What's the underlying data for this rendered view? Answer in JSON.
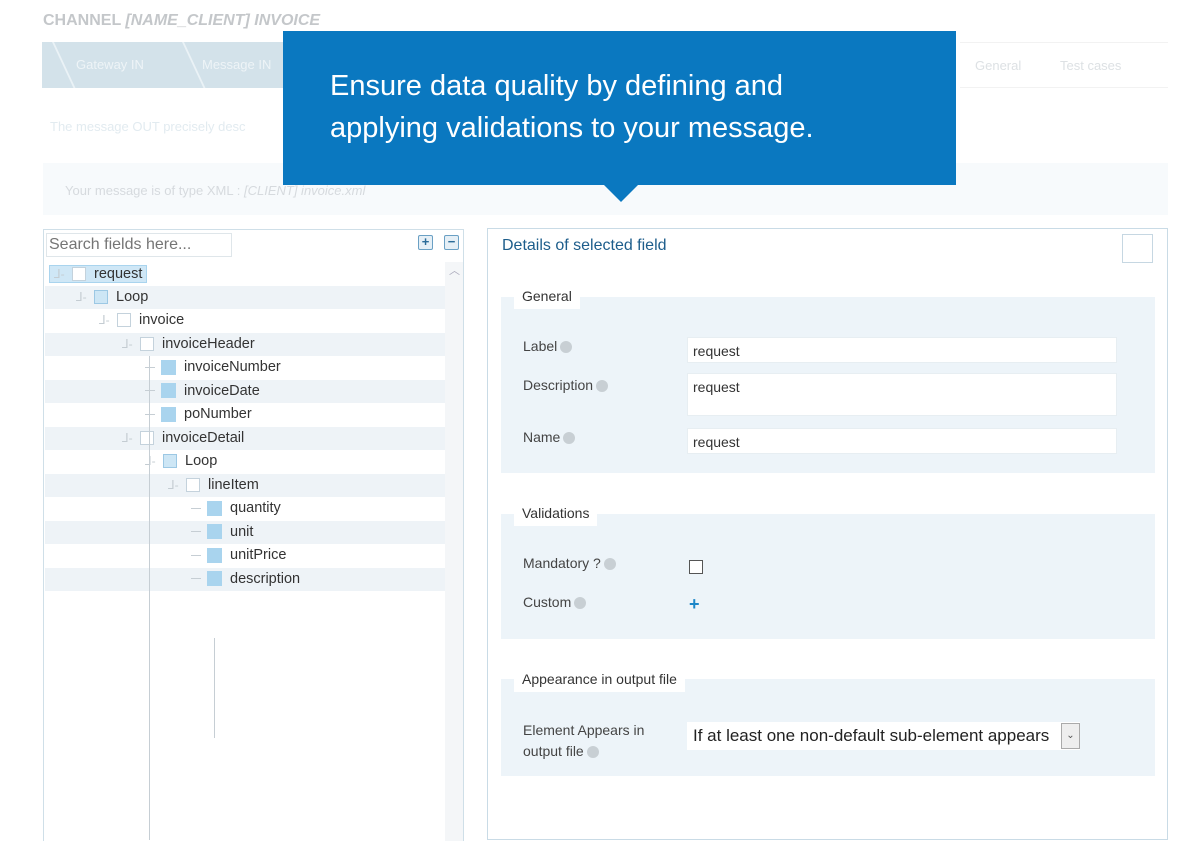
{
  "header": {
    "title_prefix": "CHANNEL",
    "title_name": "[NAME_CLIENT] INVOICE"
  },
  "breadcrumb": [
    "Gateway IN",
    "Message IN"
  ],
  "tabs": [
    "General",
    "Test cases"
  ],
  "message_description": "The message OUT precisely desc",
  "type_info": {
    "prefix": "Your message is of type XML :",
    "file": "[CLIENT] invoice.xml"
  },
  "callout": {
    "line1": "Ensure data quality by defining and",
    "line2": "applying validations to your message."
  },
  "tree": {
    "search_placeholder": "Search fields here...",
    "expand_all": "+",
    "collapse_all": "−",
    "nodes": [
      {
        "label": "request",
        "type": "element"
      },
      {
        "label": "Loop",
        "type": "loop"
      },
      {
        "label": "invoice",
        "type": "element"
      },
      {
        "label": "invoiceHeader",
        "type": "element"
      },
      {
        "label": "invoiceNumber",
        "type": "leaf"
      },
      {
        "label": "invoiceDate",
        "type": "leaf"
      },
      {
        "label": "poNumber",
        "type": "leaf"
      },
      {
        "label": "invoiceDetail",
        "type": "element"
      },
      {
        "label": "Loop",
        "type": "loop"
      },
      {
        "label": "lineItem",
        "type": "element"
      },
      {
        "label": "quantity",
        "type": "leaf"
      },
      {
        "label": "unit",
        "type": "leaf"
      },
      {
        "label": "unitPrice",
        "type": "leaf"
      },
      {
        "label": "description",
        "type": "leaf"
      }
    ]
  },
  "details": {
    "title": "Details of selected field",
    "general": {
      "legend": "General",
      "label_label": "Label",
      "label_value": "request",
      "description_label": "Description",
      "description_value": "request",
      "name_label": "Name",
      "name_value": "request"
    },
    "validations": {
      "legend": "Validations",
      "mandatory_label": "Mandatory ?",
      "mandatory_checked": false,
      "custom_label": "Custom",
      "add": "+"
    },
    "appearance": {
      "legend": "Appearance in output file",
      "label_line1": "Element Appears in",
      "label_line2": "output file",
      "selected": "If at least one non-default sub-element appears",
      "arrow": "⌄"
    }
  }
}
